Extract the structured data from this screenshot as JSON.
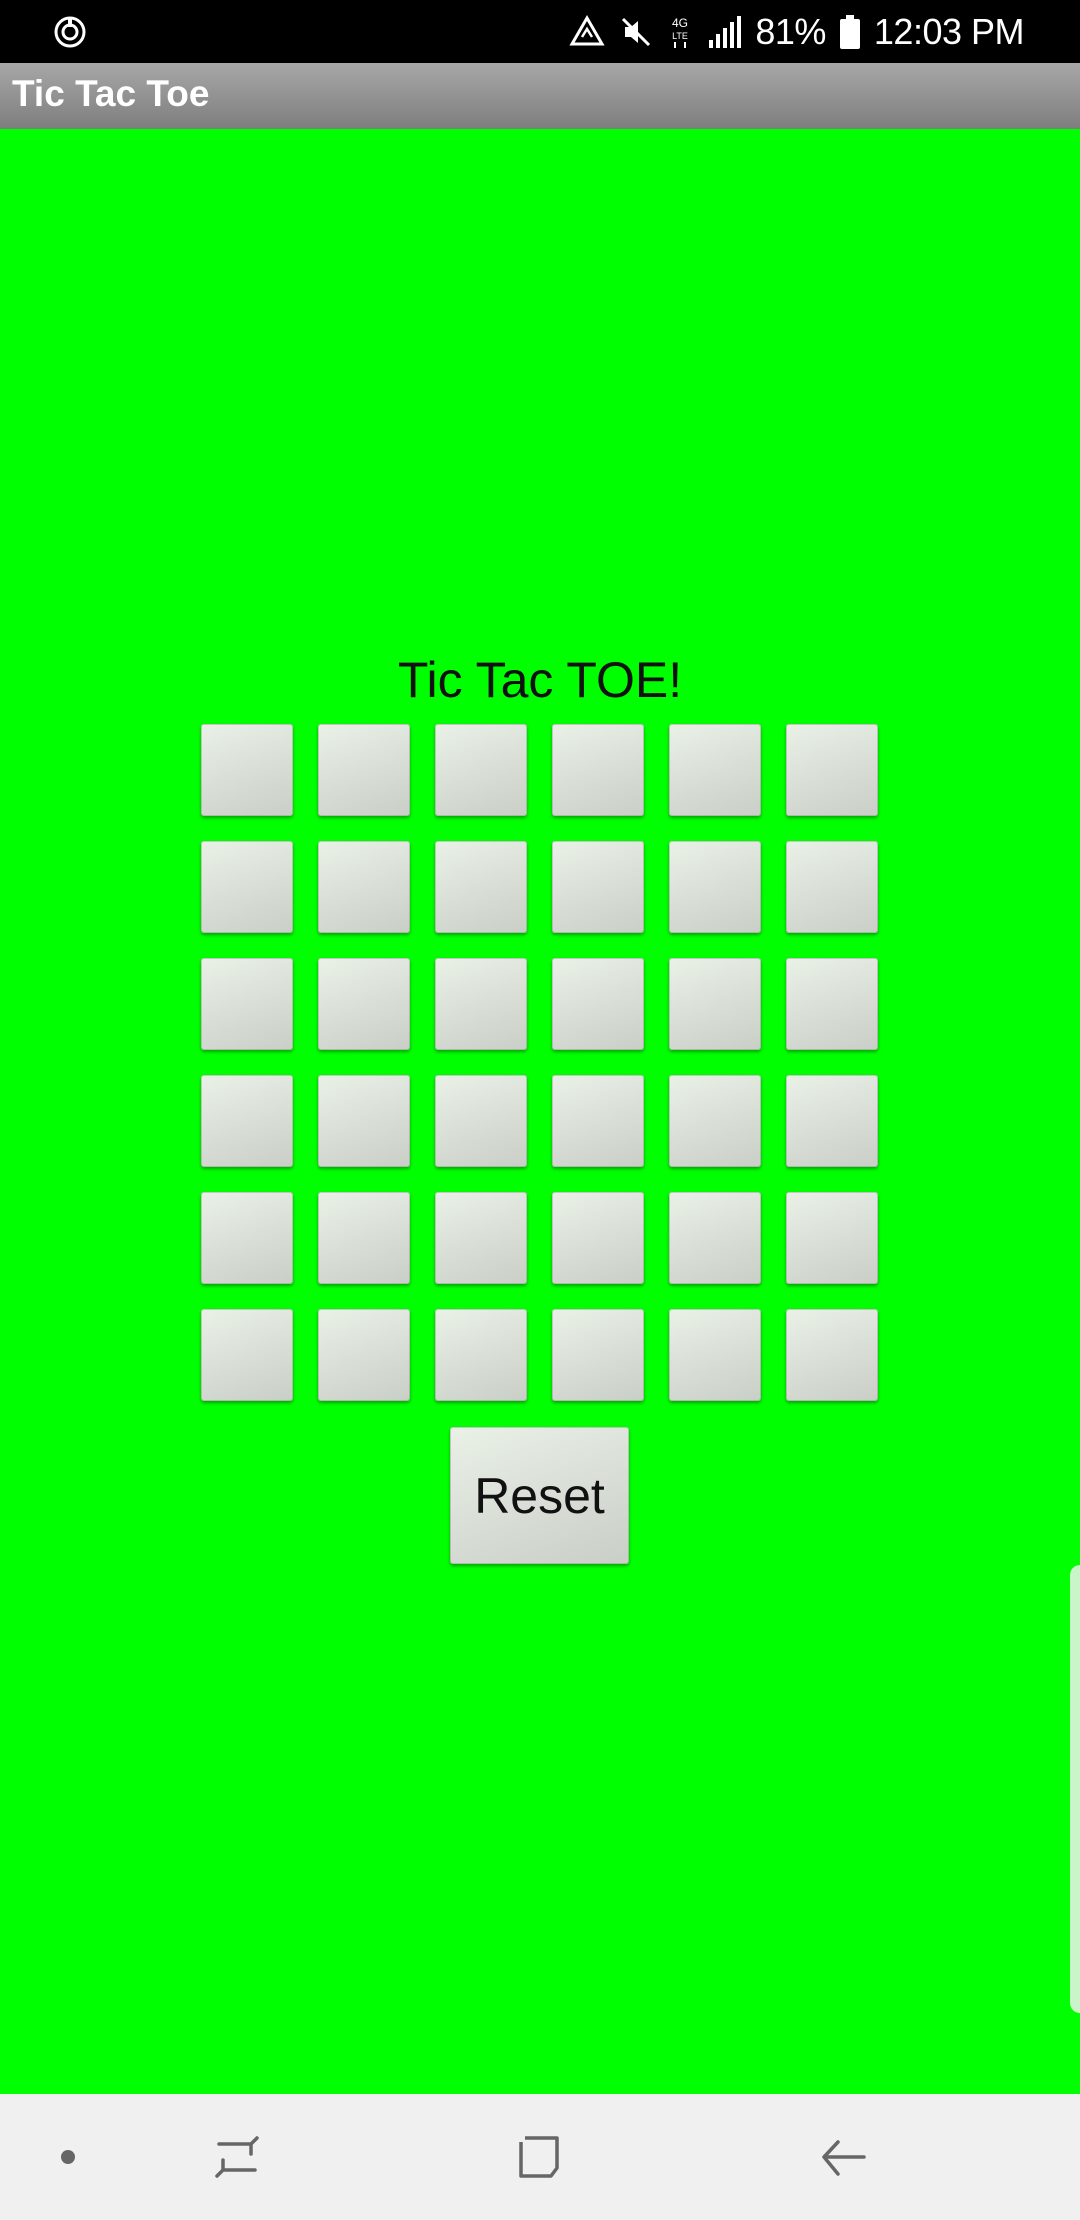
{
  "status_bar": {
    "battery_percent": "81%",
    "time": "12:03 PM",
    "icons": [
      "sync-icon",
      "data-saver-icon",
      "mute-icon",
      "4g-lte-icon",
      "signal-icon",
      "battery-icon"
    ]
  },
  "action_bar": {
    "title": "Tic Tac Toe"
  },
  "game": {
    "title": "Tic Tac TOE!",
    "rows": 6,
    "columns": 6,
    "cells": [
      [
        "",
        "",
        "",
        "",
        "",
        ""
      ],
      [
        "",
        "",
        "",
        "",
        "",
        ""
      ],
      [
        "",
        "",
        "",
        "",
        "",
        ""
      ],
      [
        "",
        "",
        "",
        "",
        "",
        ""
      ],
      [
        "",
        "",
        "",
        "",
        "",
        ""
      ],
      [
        "",
        "",
        "",
        "",
        "",
        ""
      ]
    ],
    "reset_label": "Reset"
  },
  "nav_bar": {
    "items": [
      "dot-icon",
      "recents-icon",
      "home-icon",
      "back-icon"
    ]
  },
  "colors": {
    "background": "#00ff00",
    "action_bar": "#8e8e8e",
    "button": "#d8ded6"
  }
}
